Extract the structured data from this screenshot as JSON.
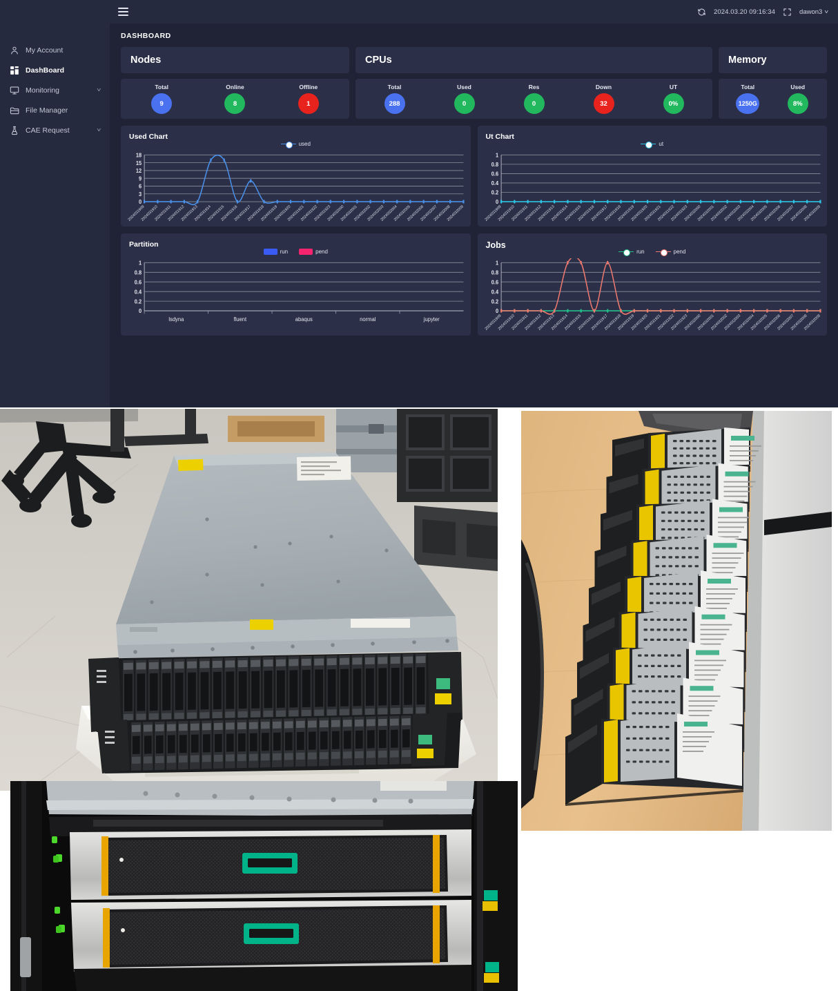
{
  "app": {
    "breadcrumb": "DASHBOARD",
    "topbar": {
      "menu_icon": "hamburger-icon",
      "refresh_icon": "refresh-icon",
      "timestamp": "2024.03.20 09:16:34",
      "fullscreen_icon": "fullscreen-icon",
      "user": "dawon3",
      "user_caret": "˅"
    },
    "sidebar": {
      "items": [
        {
          "label": "My Account",
          "icon": "user-icon",
          "active": false,
          "caret": ""
        },
        {
          "label": "DashBoard",
          "icon": "grid-icon",
          "active": true,
          "caret": ""
        },
        {
          "label": "Monitoring",
          "icon": "monitor-icon",
          "active": false,
          "caret": "˅"
        },
        {
          "label": "File Manager",
          "icon": "folder-icon",
          "active": false,
          "caret": ""
        },
        {
          "label": "CAE Request",
          "icon": "flask-icon",
          "active": false,
          "caret": "˅"
        }
      ]
    },
    "cards": {
      "nodes": {
        "title": "Nodes",
        "stats": [
          {
            "label": "Total",
            "value": "9",
            "color": "#4a72f0"
          },
          {
            "label": "Online",
            "value": "8",
            "color": "#22b95e"
          },
          {
            "label": "Offline",
            "value": "1",
            "color": "#e8231d"
          }
        ]
      },
      "cpus": {
        "title": "CPUs",
        "stats": [
          {
            "label": "Total",
            "value": "288",
            "color": "#4a72f0"
          },
          {
            "label": "Used",
            "value": "0",
            "color": "#22b95e"
          },
          {
            "label": "Res",
            "value": "0",
            "color": "#22b95e"
          },
          {
            "label": "Down",
            "value": "32",
            "color": "#e8231d"
          },
          {
            "label": "UT",
            "value": "0%",
            "color": "#22b95e"
          }
        ]
      },
      "memory": {
        "title": "Memory",
        "stats": [
          {
            "label": "Total",
            "value": "1250G",
            "color": "#4a72f0"
          },
          {
            "label": "Used",
            "value": "8%",
            "color": "#22b95e"
          }
        ]
      }
    }
  },
  "chart_data": [
    {
      "id": "used-chart",
      "type": "line",
      "title": "Used Chart",
      "xlabel": "",
      "ylabel": "",
      "ylim": [
        0,
        18
      ],
      "yticks": [
        0,
        3,
        6,
        9,
        12,
        15,
        18
      ],
      "grid": true,
      "legend_position": "top-center",
      "x": [
        "2024031909",
        "2024031910",
        "2024031911",
        "2024031912",
        "2024031913",
        "2024031914",
        "2024031915",
        "2024031916",
        "2024031917",
        "2024031918",
        "2024031919",
        "2024031920",
        "2024031921",
        "2024031922",
        "2024031923",
        "2024032000",
        "2024032001",
        "2024032002",
        "2024032003",
        "2024032004",
        "2024032005",
        "2024032006",
        "2024032007",
        "2024032008",
        "2024032009"
      ],
      "series": [
        {
          "name": "used",
          "color": "#4a90e8",
          "values": [
            0,
            0,
            0,
            0,
            0,
            16,
            16,
            0,
            8,
            0,
            0,
            0,
            0,
            0,
            0,
            0,
            0,
            0,
            0,
            0,
            0,
            0,
            0,
            0,
            0
          ]
        }
      ]
    },
    {
      "id": "ut-chart",
      "type": "line",
      "title": "Ut Chart",
      "xlabel": "",
      "ylabel": "",
      "ylim": [
        0,
        1
      ],
      "yticks": [
        0,
        0.2,
        0.4,
        0.6,
        0.8,
        1
      ],
      "ytick_labels": [
        "0",
        "0.2",
        "0.4",
        "0.6",
        "0.8",
        "1"
      ],
      "grid": true,
      "legend_position": "top-center",
      "x": [
        "2024031909",
        "2024031910",
        "2024031911",
        "2024031912",
        "2024031913",
        "2024031914",
        "2024031915",
        "2024031916",
        "2024031917",
        "2024031918",
        "2024031919",
        "2024031920",
        "2024031921",
        "2024031922",
        "2024031923",
        "2024032000",
        "2024032001",
        "2024032002",
        "2024032003",
        "2024032004",
        "2024032005",
        "2024032006",
        "2024032007",
        "2024032008",
        "2024032009"
      ],
      "series": [
        {
          "name": "ut",
          "color": "#2ec5e6",
          "values": [
            0,
            0,
            0,
            0,
            0,
            0,
            0,
            0,
            0,
            0,
            0,
            0,
            0,
            0,
            0,
            0,
            0,
            0,
            0,
            0,
            0,
            0,
            0,
            0,
            0
          ]
        }
      ]
    },
    {
      "id": "partition-chart",
      "type": "bar",
      "title": "Partition",
      "xlabel": "",
      "ylabel": "",
      "ylim": [
        0,
        1
      ],
      "yticks": [
        0,
        0.2,
        0.4,
        0.6,
        0.8,
        1
      ],
      "ytick_labels": [
        "0",
        "0.2",
        "0.4",
        "0.6",
        "0.8",
        "1"
      ],
      "grid": true,
      "legend_position": "top-center",
      "categories": [
        "lsdyna",
        "fluent",
        "abaqus",
        "normal",
        "jupyter"
      ],
      "series": [
        {
          "name": "run",
          "color": "#3b5bf5",
          "values": [
            0,
            0,
            0,
            0,
            0
          ]
        },
        {
          "name": "pend",
          "color": "#f5246e",
          "values": [
            0,
            0,
            0,
            0,
            0
          ]
        }
      ]
    },
    {
      "id": "jobs-chart",
      "type": "line",
      "title": "Jobs",
      "xlabel": "",
      "ylabel": "",
      "ylim": [
        0,
        1
      ],
      "yticks": [
        0,
        0.2,
        0.4,
        0.6,
        0.8,
        1
      ],
      "ytick_labels": [
        "0",
        "0.2",
        "0.4",
        "0.6",
        "0.8",
        "1"
      ],
      "grid": true,
      "legend_position": "top-center",
      "x": [
        "2024031909",
        "2024031910",
        "2024031911",
        "2024031912",
        "2024031913",
        "2024031914",
        "2024031915",
        "2024031916",
        "2024031917",
        "2024031918",
        "2024031919",
        "2024031920",
        "2024031921",
        "2024031922",
        "2024031923",
        "2024032000",
        "2024032001",
        "2024032002",
        "2024032003",
        "2024032004",
        "2024032005",
        "2024032006",
        "2024032007",
        "2024032008",
        "2024032009"
      ],
      "series": [
        {
          "name": "run",
          "color": "#24c08a",
          "values": [
            0,
            0,
            0,
            0,
            0,
            0,
            0,
            0,
            0,
            0,
            0,
            0,
            0,
            0,
            0,
            0,
            0,
            0,
            0,
            0,
            0,
            0,
            0,
            0,
            0
          ]
        },
        {
          "name": "pend",
          "color": "#f0796f",
          "values": [
            0,
            0,
            0,
            0,
            0,
            1,
            1,
            0,
            1,
            0,
            0,
            0,
            0,
            0,
            0,
            0,
            0,
            0,
            0,
            0,
            0,
            0,
            0,
            0,
            0
          ]
        }
      ]
    }
  ],
  "photos": [
    {
      "id": "photo-1",
      "caption": "Storage array chassis with dual rows of drive bays, resting on white foam packaging on a tiled floor"
    },
    {
      "id": "photo-2",
      "caption": "Row of hard disk drives in black carrier caddies lined up on a wooden desk"
    },
    {
      "id": "photo-3",
      "caption": "Two rack-mounted HPE storage enclosures with green logo badges and green status LEDs"
    }
  ]
}
